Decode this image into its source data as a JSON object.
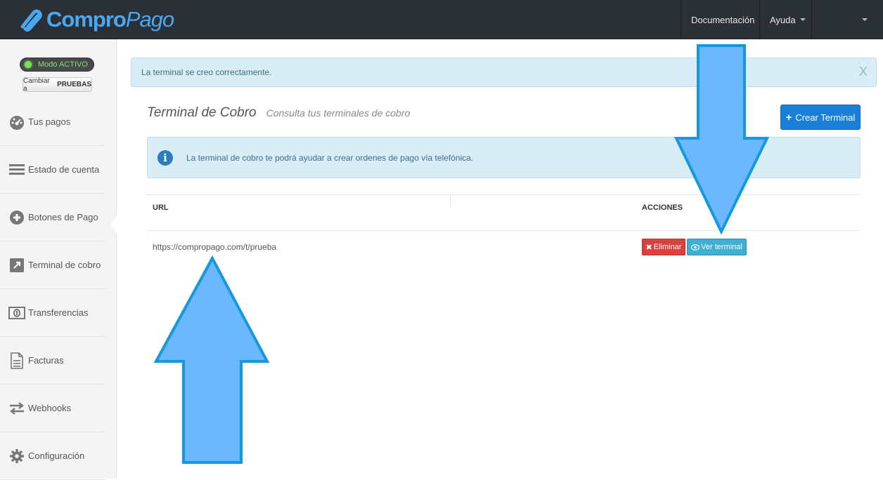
{
  "brand": {
    "name_part1": "Compro",
    "name_part2": "Pago"
  },
  "topnav": {
    "documentation": "Documentación",
    "help": "Ayuda"
  },
  "sidebar": {
    "mode_label": "Modo ACTIVO",
    "switch_prefix": "Cambiar a",
    "switch_mode": "PRUEBAS",
    "items": [
      {
        "label": "Tus pagos",
        "icon": "dashboard-icon"
      },
      {
        "label": "Estado de cuenta",
        "icon": "list-icon"
      },
      {
        "label": "Botones de Pago",
        "icon": "plus-circle-icon"
      },
      {
        "label": "Terminal de cobro",
        "icon": "external-link-icon"
      },
      {
        "label": "Transferencias",
        "icon": "money-icon"
      },
      {
        "label": "Facturas",
        "icon": "document-icon"
      },
      {
        "label": "Webhooks",
        "icon": "exchange-icon"
      },
      {
        "label": "Configuración",
        "icon": "gear-icon"
      }
    ],
    "active_index": 3
  },
  "alert_success": {
    "text": "La terminal se creo correctamente.",
    "close": "X"
  },
  "header": {
    "title": "Terminal de Cobro",
    "subtitle": "Consulta tus terminales de cobro"
  },
  "create_button": {
    "label": "Crear Terminal"
  },
  "alert_info": {
    "text": "La terminal de cobro te podrá ayudar a crear ordenes de pago vía telefónica."
  },
  "table": {
    "columns": [
      "URL",
      "ACCIONES"
    ],
    "rows": [
      {
        "url": "https://compropago.com/t/prueba"
      }
    ],
    "delete_label": "Eliminar",
    "view_label": "Ver terminal"
  },
  "colors": {
    "topbar": "#2b2f36",
    "accent": "#1a7fd8",
    "danger": "#d9413c",
    "info_btn": "#3fb0d2",
    "annotation_arrow": "#6bb8ff"
  }
}
